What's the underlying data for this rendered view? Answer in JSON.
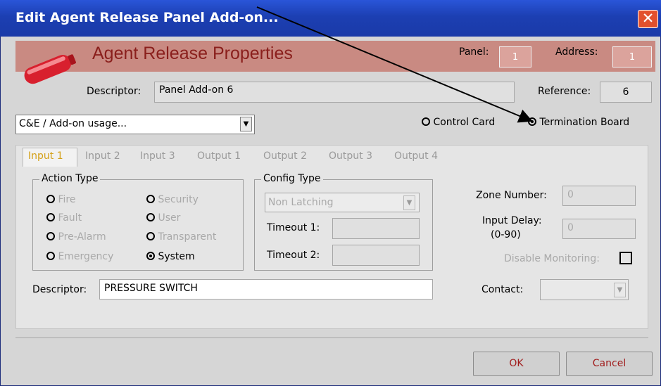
{
  "window": {
    "title": "Edit Agent Release Panel Add-on..."
  },
  "banner": {
    "title": "Agent Release Properties",
    "panel_label": "Panel:",
    "panel_value": "1",
    "address_label": "Address:",
    "address_value": "1"
  },
  "descriptor_row": {
    "label": "Descriptor:",
    "value": "Panel Add-on 6",
    "reference_label": "Reference:",
    "reference_value": "6"
  },
  "usage_dropdown": {
    "value": "C&E / Add-on usage..."
  },
  "mode": {
    "control_card": "Control Card",
    "termination_board": "Termination Board",
    "selected": "Termination Board"
  },
  "tabs": [
    "Input 1",
    "Input 2",
    "Input 3",
    "Output 1",
    "Output 2",
    "Output 3",
    "Output 4"
  ],
  "action_type": {
    "title": "Action Type",
    "options": [
      "Fire",
      "Security",
      "Fault",
      "User",
      "Pre-Alarm",
      "Transparent",
      "Emergency",
      "System"
    ],
    "selected": "System"
  },
  "config_type": {
    "title": "Config Type",
    "value": "Non Latching",
    "timeout1_label": "Timeout 1:",
    "timeout2_label": "Timeout 2:"
  },
  "zone": {
    "label": "Zone Number:",
    "value": "0"
  },
  "input_delay": {
    "label1": "Input Delay:",
    "label2": "(0-90)",
    "value": "0"
  },
  "disable_monitoring": {
    "label": "Disable Monitoring:"
  },
  "input_descriptor": {
    "label": "Descriptor:",
    "value": "PRESSURE SWITCH"
  },
  "contact": {
    "label": "Contact:"
  },
  "buttons": {
    "ok": "OK",
    "cancel": "Cancel"
  },
  "colors": {
    "titlebar": "#1c3fb2",
    "banner": "#c98a82",
    "banner_text": "#8a1f1c",
    "button_text": "#a11d1d",
    "active_tab": "#d4a017"
  }
}
